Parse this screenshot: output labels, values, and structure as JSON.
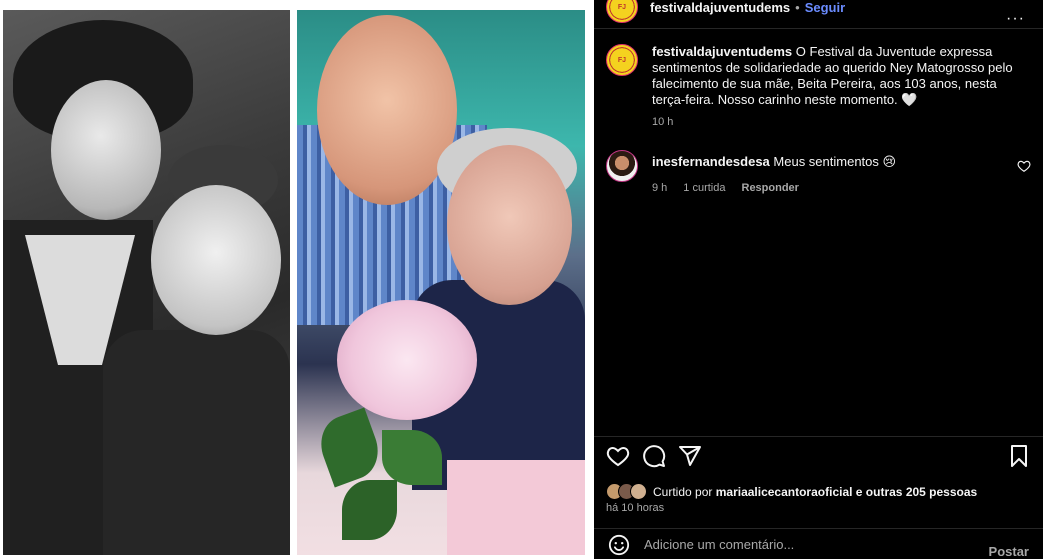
{
  "post": {
    "username": "festivaldajuventudems",
    "dot": "•",
    "follow_label": "Seguir",
    "more_label": "···",
    "caption_user": "festivaldajuventudems",
    "caption_text": "O Festival da Juventude expressa sentimentos de solidariedade ao querido Ney Matogrosso pelo falecimento de sua mãe, Beita Pereira, aos 103 anos, nesta terça-feira. Nosso carinho neste momento. 🤍",
    "caption_time": "10 h"
  },
  "comment": {
    "username": "inesfernandesdesa",
    "text": "Meus sentimentos 😢",
    "time": "9 h",
    "likes": "1 curtida",
    "reply_label": "Responder"
  },
  "likes": {
    "prefix": "Curtido por",
    "user": "mariaalicecantoraoficial",
    "suffix": "e outras 205 pessoas"
  },
  "time_ago": "há 10 horas",
  "add_comment": {
    "placeholder": "Adicione um comentário...",
    "post_label": "Postar"
  },
  "icons": {
    "like": "heart-icon",
    "comment": "comment-icon",
    "share": "share-icon",
    "save": "bookmark-icon",
    "emoji": "emoji-icon"
  },
  "colors": {
    "background": "#000000",
    "link": "#6b8cff",
    "secondary_text": "#a8a8a8"
  }
}
